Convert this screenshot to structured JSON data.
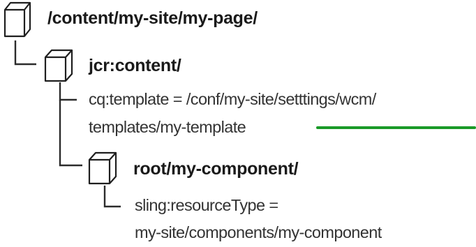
{
  "tree": {
    "root": {
      "label": "/content/my-site/my-page/",
      "icon": "cube-icon"
    },
    "jcr_content": {
      "label": "jcr:content/",
      "icon": "cube-icon",
      "properties": [
        {
          "line1": "cq:template = /conf/my-site/setttings/wcm/",
          "line2": "templates/my-template"
        }
      ]
    },
    "component": {
      "label": "root/my-component/",
      "icon": "cube-icon",
      "properties": [
        {
          "line1": "sling:resourceType =",
          "line2": "my-site/components/my-component"
        }
      ]
    }
  },
  "colors": {
    "text": "#333333",
    "connector": "#2b2b2b",
    "icon_stroke": "#1f1f1f",
    "accent": "#1a9a28"
  }
}
